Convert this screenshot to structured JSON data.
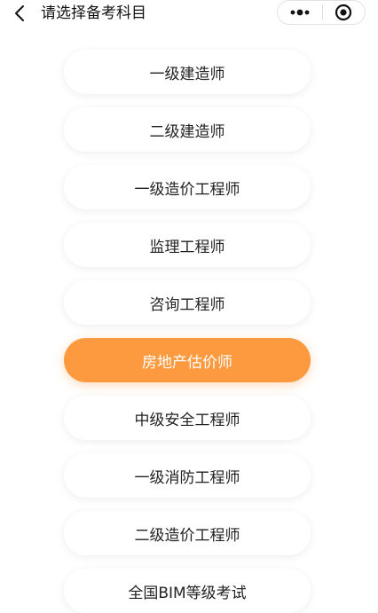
{
  "header": {
    "title": "请选择备考科目",
    "back_icon": "chevron-left-icon",
    "more_icon": "more-dots-icon",
    "close_icon": "target-circle-icon"
  },
  "subjects": [
    {
      "label": "一级建造师",
      "selected": false
    },
    {
      "label": "二级建造师",
      "selected": false
    },
    {
      "label": "一级造价工程师",
      "selected": false
    },
    {
      "label": "监理工程师",
      "selected": false
    },
    {
      "label": "咨询工程师",
      "selected": false
    },
    {
      "label": "房地产估价师",
      "selected": true
    },
    {
      "label": "中级安全工程师",
      "selected": false
    },
    {
      "label": "一级消防工程师",
      "selected": false
    },
    {
      "label": "二级造价工程师",
      "selected": false
    },
    {
      "label": "全国BIM等级考试",
      "selected": false
    }
  ],
  "colors": {
    "accent": "#fd9a3f",
    "text": "#222222",
    "selected_text": "#ffffff"
  }
}
